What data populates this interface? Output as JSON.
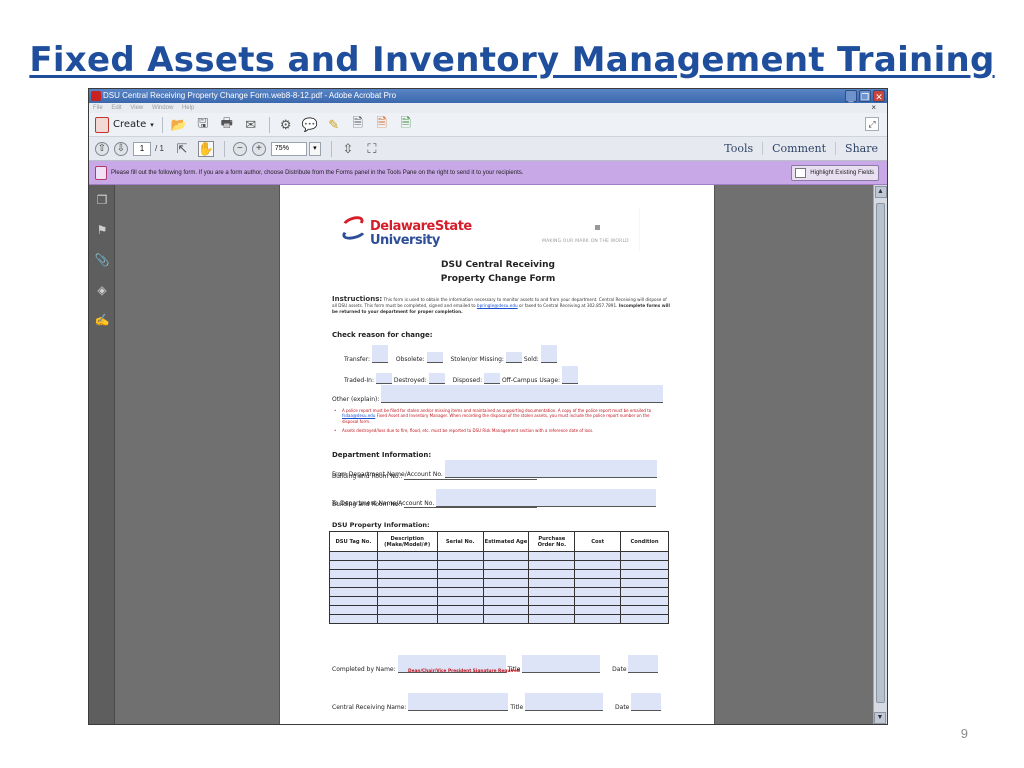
{
  "slide": {
    "title": "Fixed Assets and Inventory Management Training",
    "page_number": "9"
  },
  "window": {
    "title": "DSU Central Receiving Property Change Form.web8-8-12.pdf - Adobe Acrobat Pro",
    "menu": [
      "File",
      "Edit",
      "View",
      "Window",
      "Help"
    ]
  },
  "toolbar": {
    "create_label": "Create",
    "current_page": "1",
    "page_total": "/ 1",
    "zoom": "75%",
    "tabs": [
      "Tools",
      "Comment",
      "Share"
    ]
  },
  "form_message": {
    "text": "Please fill out the following form. If you are a form author, choose Distribute from the Forms panel in the Tools Pane on the right to send it to your recipients.",
    "highlight_button": "Highlight Existing Fields"
  },
  "colors": {
    "accent": "#1f4e9c",
    "form_bar": "#c9a8e8",
    "field_fill": "#dde4f7",
    "dsu_red": "#d41f2b",
    "dsu_blue": "#2d4f9a"
  },
  "doc": {
    "logo_line1": "DelawareState",
    "logo_line2": "University",
    "motto": "MAKING OUR MARK ON THE WORLD",
    "title_line1": "DSU Central Receiving",
    "title_line2": "Property Change Form",
    "instr_lead": "Instructions:",
    "instr_text1": "This form is used to obtain the information necessary to monitor assets to and from your department. Central Receiving will dispose of all DSU assets. This form must be completed, signed and emailed to",
    "instr_email": "bpringle@desu.edu",
    "instr_text2": "or faxed to Central Receiving at 302.857.7891.",
    "instr_bold": "Incomplete forms will be returned to your department for proper completion.",
    "check_heading": "Check reason for change:",
    "reasons": {
      "transfer": "Transfer:",
      "obsolete": "Obsolete:",
      "stolen": "Stolen/or Missing:",
      "sold": "Sold:",
      "traded": "Traded-In:",
      "destroyed": "Destroyed:",
      "disposed": "Disposed:",
      "offcampus": "Off-Campus Usage:"
    },
    "other_label": "Other (explain):",
    "bullet1_a": "A police report must be filed for stolen and/or missing items and maintained as supporting documentation. A copy of the police report must be emailed to",
    "bullet1_email": "fsdaa@desu.edu",
    "bullet1_b": "Fixed Asset and Inventory Manager. When recording the disposal of the stolen assets, you must include the police report number on the disposal form.",
    "bullet2": "Assets destroyed/loss due to fire, flood, etc. must be reported to DSU Risk Management section with a reference date of loss.",
    "dept_heading": "Department Information:",
    "from_dept": "From Department Name/Account No.",
    "building1": "Building and Room No.:",
    "to_dept": "To Department Name/Account No.",
    "building2": "Building and Room No.:",
    "property_heading": "DSU Property Information:",
    "table_headers": [
      "DSU Tag No.",
      "Description (Make/Model/#)",
      "Serial No.",
      "Estimated Age",
      "Purchase Order No.",
      "Cost",
      "Condition"
    ],
    "completed_by": "Completed by Name:",
    "title_label": "Title",
    "date_label": "Date",
    "signature_note": "Dean/Chair/Vice President Signature Required",
    "central_receiving": "Central Receiving Name:"
  }
}
